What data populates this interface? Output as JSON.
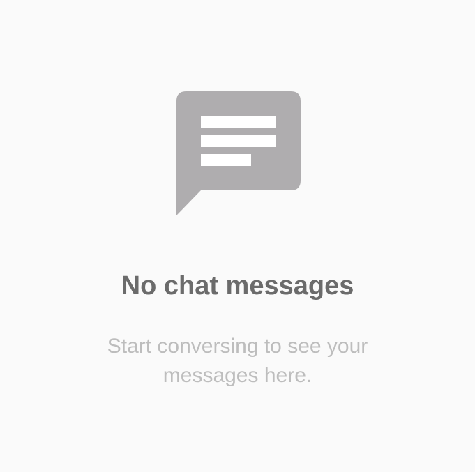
{
  "empty_state": {
    "icon": "chat-message-icon",
    "title": "No chat messages",
    "subtitle_line1": "Start conversing to see your",
    "subtitle_line2": "messages here."
  },
  "colors": {
    "background": "#fafafa",
    "icon": "#afadaf",
    "title": "#6b6b6b",
    "subtitle": "#bdbdbd"
  }
}
